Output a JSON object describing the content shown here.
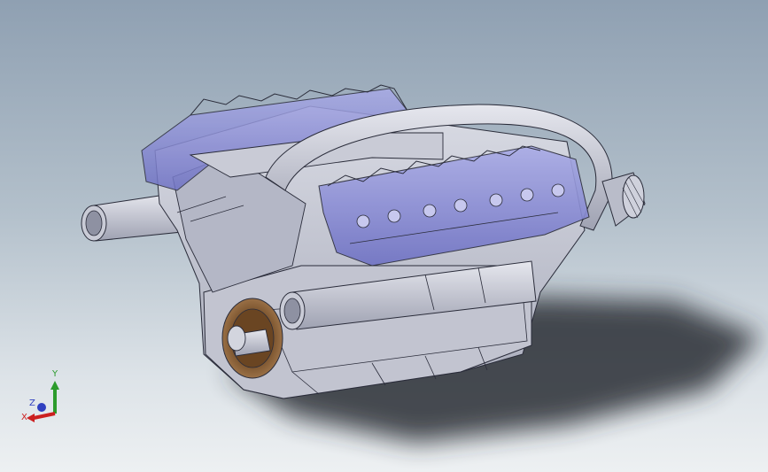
{
  "viewport": {
    "background_top": "#8fa0b2",
    "background_bottom": "#edf0f2"
  },
  "model": {
    "body_color": "#c8cad6",
    "head_color": "#8a8cd6",
    "flange_color": "#7a5430",
    "edge_color": "#2a2c3a"
  },
  "triad": {
    "y_label": "Y",
    "z_label": "Z",
    "x_label": "X",
    "y_color": "#2c9b2c",
    "x_color": "#cc2020",
    "z_color": "#3040c0"
  }
}
